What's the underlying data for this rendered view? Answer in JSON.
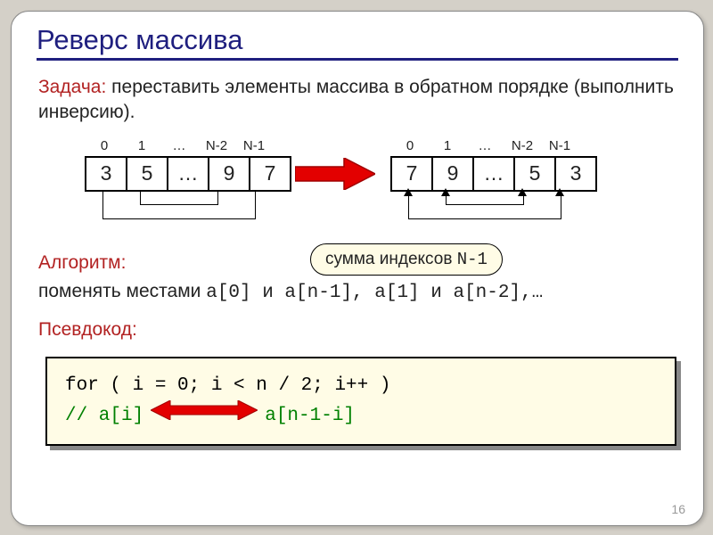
{
  "title": "Реверс массива",
  "task": {
    "label": "Задача:",
    "text": "переставить элементы массива в обратном порядке (выполнить инверсию)."
  },
  "indices": [
    "0",
    "1",
    "…",
    "N-2",
    "N-1"
  ],
  "array_before": [
    "3",
    "5",
    "…",
    "9",
    "7"
  ],
  "array_after": [
    "7",
    "9",
    "…",
    "5",
    "3"
  ],
  "algorithm": {
    "label": "Алгоритм:",
    "text_prefix": "поменять местами ",
    "code_part": "a[0] и a[n-1], a[1] и a[n-2],…"
  },
  "callout": "сумма индексов N-1",
  "pseudocode": {
    "label": "Псевдокод:",
    "line1": "for ( i = 0; i < n / 2; i++ )",
    "line2_left": " // a[i]",
    "line2_right": "a[n-1-i]"
  },
  "page_number": "16",
  "colors": {
    "title": "#1f1f7f",
    "red_arrow": "#e30000",
    "callout_bg": "#fffce6"
  }
}
